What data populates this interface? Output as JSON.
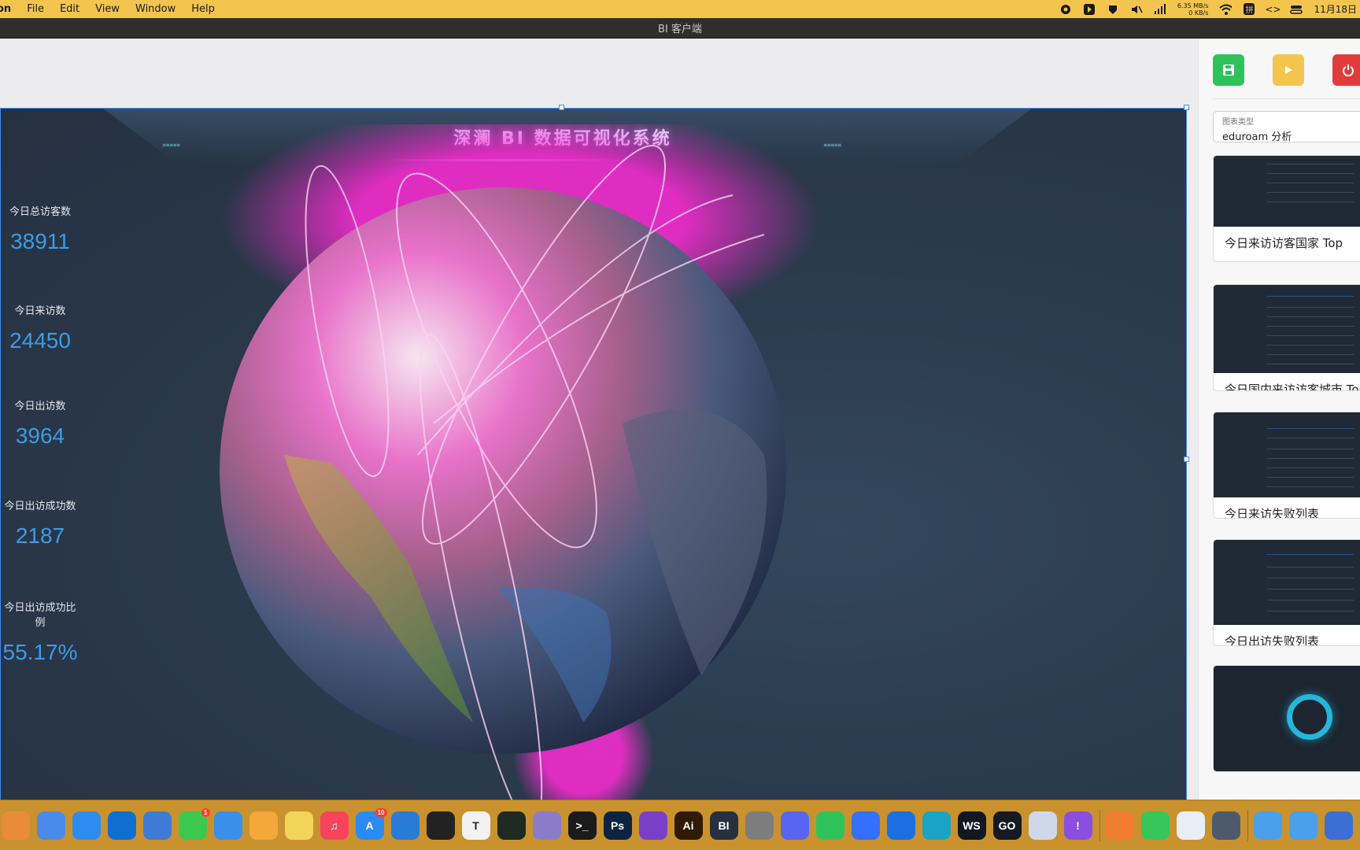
{
  "menubar": {
    "app_name": "on",
    "items": [
      "File",
      "Edit",
      "View",
      "Window",
      "Help"
    ],
    "net_up": "6.35 MB/s",
    "net_down": "0 KB/s",
    "input_method": "拼",
    "date": "11月18日"
  },
  "window": {
    "title": "BI 客户端"
  },
  "dashboard": {
    "title": "深澜 BI 数据可视化系统",
    "stats": [
      {
        "label": "今日总访客数",
        "value": "38911"
      },
      {
        "label": "今日来访数",
        "value": "24450"
      },
      {
        "label": "今日出访数",
        "value": "3964"
      },
      {
        "label": "今日出访成功数",
        "value": "2187"
      },
      {
        "label": "今日出访成功比例",
        "value": "55.17%"
      }
    ]
  },
  "panel": {
    "chart_type_label": "图表类型",
    "chart_type_value": "eduroam 分析",
    "cards": [
      {
        "caption": "今日来访访客国家 Top"
      },
      {
        "caption": "今日国内来访访客城市 Top"
      },
      {
        "caption": "今日来访失败列表"
      },
      {
        "caption": "今日出访失败列表"
      },
      {
        "caption": ""
      }
    ]
  },
  "dock": {
    "icons": [
      {
        "name": "launchpad-icon",
        "label": "",
        "color": "#e88c3a"
      },
      {
        "name": "chrome-icon",
        "label": "",
        "color": "#4a8bea"
      },
      {
        "name": "safari-icon",
        "label": "",
        "color": "#2e8cf0"
      },
      {
        "name": "paw-icon",
        "label": "",
        "color": "#0f6fd1"
      },
      {
        "name": "teams-icon",
        "label": "",
        "color": "#3e7bd6"
      },
      {
        "name": "messages-icon",
        "label": "",
        "color": "#3ec74f",
        "badge": "1"
      },
      {
        "name": "mail-icon",
        "label": "",
        "color": "#3a8fe8"
      },
      {
        "name": "photos-icon",
        "label": "",
        "color": "#f4a83a"
      },
      {
        "name": "notes-icon",
        "label": "",
        "color": "#f3d45b"
      },
      {
        "name": "music-icon",
        "label": "♫",
        "color": "#f8435b"
      },
      {
        "name": "appstore-icon",
        "label": "A",
        "color": "#2b8af7",
        "badge": "10"
      },
      {
        "name": "vscode-icon",
        "label": "",
        "color": "#2a7bd8"
      },
      {
        "name": "figma-icon",
        "label": "",
        "color": "#222222"
      },
      {
        "name": "typora-icon",
        "label": "T",
        "color": "#f2f2f2"
      },
      {
        "name": "activity-monitor-icon",
        "label": "",
        "color": "#1f2a22"
      },
      {
        "name": "archive-icon",
        "label": "",
        "color": "#8b7cc9"
      },
      {
        "name": "terminal-icon",
        "label": ">_",
        "color": "#1b1b1b"
      },
      {
        "name": "photoshop-icon",
        "label": "Ps",
        "color": "#0b2540"
      },
      {
        "name": "github-icon",
        "label": "",
        "color": "#7a3fc8"
      },
      {
        "name": "illustrator-icon",
        "label": "Ai",
        "color": "#2f1a05"
      },
      {
        "name": "bi-client-icon",
        "label": "BI",
        "color": "#26303f"
      },
      {
        "name": "system-settings-icon",
        "label": "",
        "color": "#7d7d7d"
      },
      {
        "name": "discord-icon",
        "label": "",
        "color": "#5865f2"
      },
      {
        "name": "wechat-icon",
        "label": "",
        "color": "#2fc25b"
      },
      {
        "name": "feishu-icon",
        "label": "",
        "color": "#3370ff"
      },
      {
        "name": "send-icon",
        "label": "",
        "color": "#1c6fe0"
      },
      {
        "name": "edge-preview-icon",
        "label": "",
        "color": "#1aa3c4"
      },
      {
        "name": "webstorm-icon",
        "label": "WS",
        "color": "#101820"
      },
      {
        "name": "goland-icon",
        "label": "GO",
        "color": "#161a22"
      },
      {
        "name": "finder-folder-icon",
        "label": "",
        "color": "#cfd8e8"
      },
      {
        "name": "feedback-icon",
        "label": "!",
        "color": "#8a4fe0"
      },
      {
        "name": "infuse-icon",
        "label": "",
        "color": "#f17d2e"
      },
      {
        "name": "facetime-icon",
        "label": "",
        "color": "#35c759"
      },
      {
        "name": "istat-icon",
        "label": "",
        "color": "#e8eef6"
      },
      {
        "name": "electron-icon",
        "label": "",
        "color": "#4d5a6b"
      },
      {
        "name": "folder-icon",
        "label": "",
        "color": "#4aa0ea"
      },
      {
        "name": "folder-icon-2",
        "label": "",
        "color": "#4aa0ea"
      },
      {
        "name": "window-icon",
        "label": "",
        "color": "#3b6fd4"
      }
    ]
  }
}
